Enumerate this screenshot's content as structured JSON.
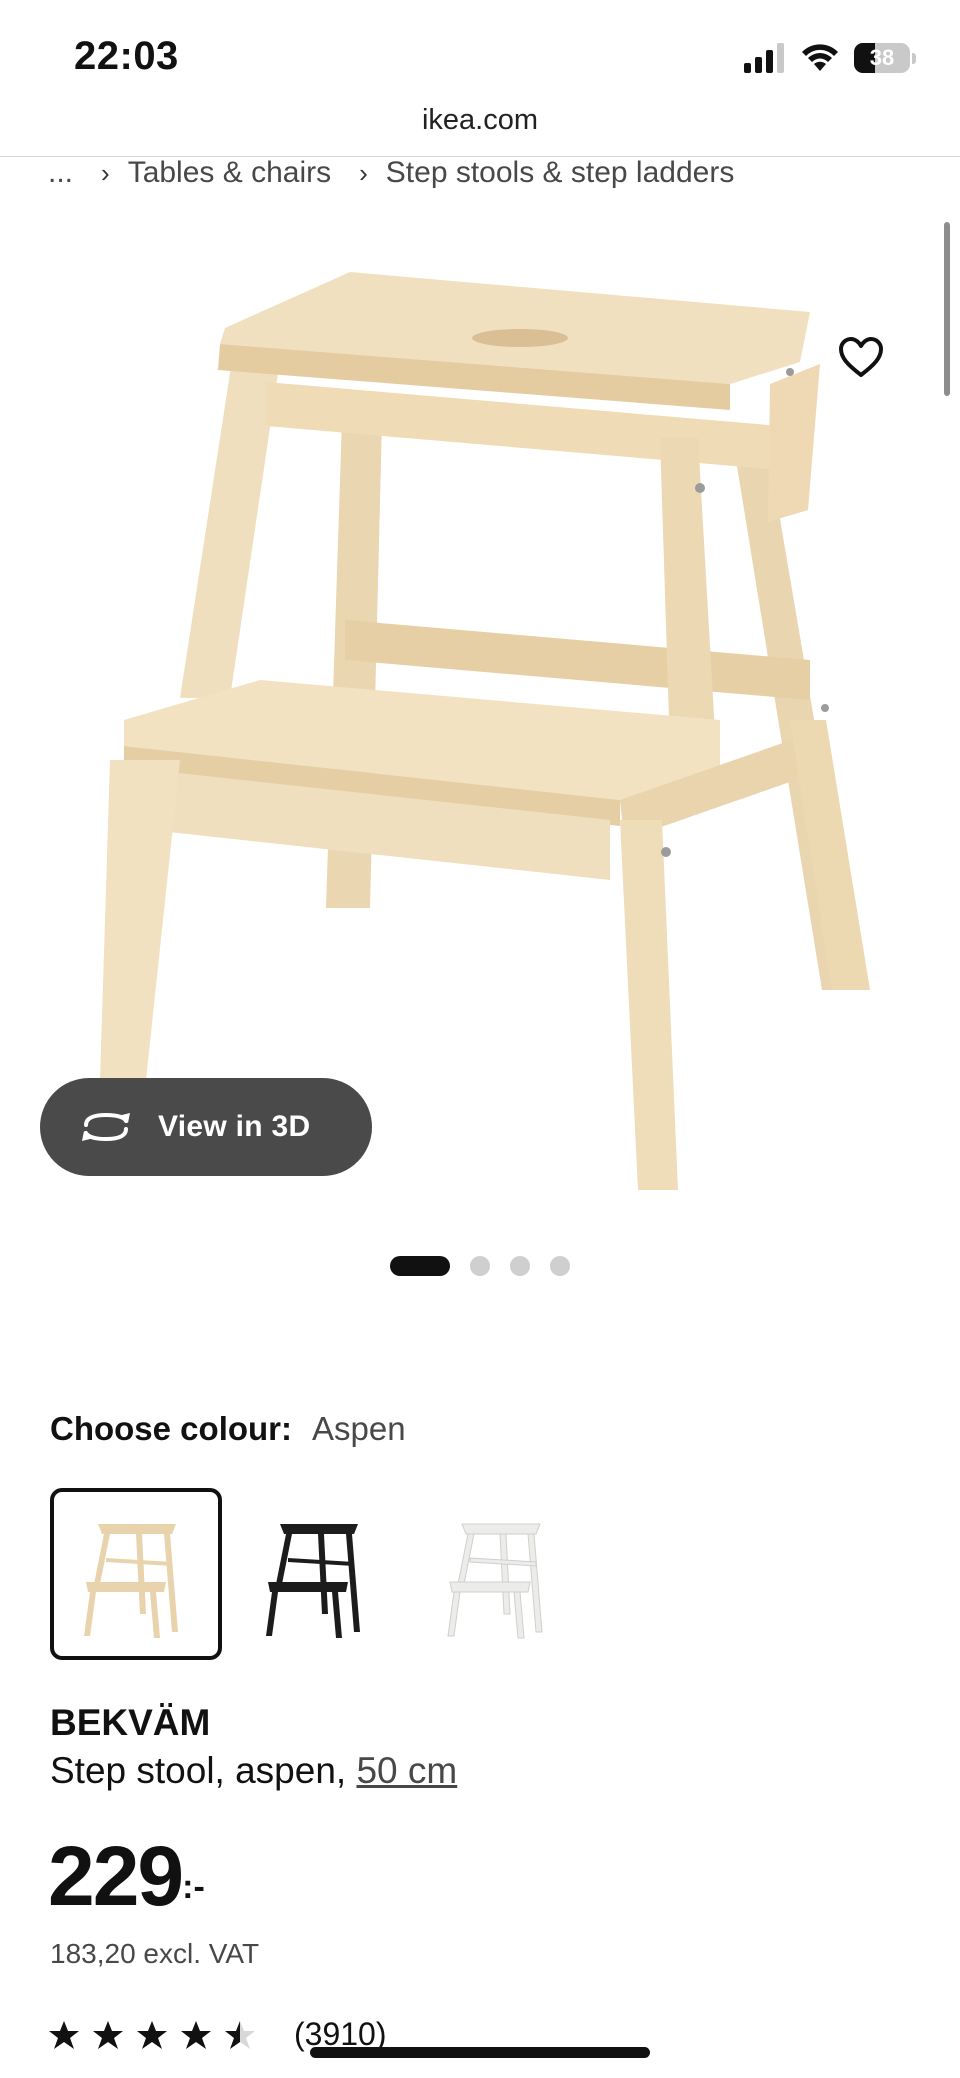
{
  "status_bar": {
    "time": "22:03",
    "battery": "38",
    "battery_level": 38
  },
  "browser": {
    "url": "ikea.com"
  },
  "breadcrumb": {
    "ellipsis": "...",
    "items": [
      "Tables & chairs",
      "Step stools & step ladders"
    ]
  },
  "gallery": {
    "view_3d_label": "View in 3D",
    "dot_count": 4,
    "active_dot": 0
  },
  "colour": {
    "label": "Choose colour:",
    "selected": "Aspen",
    "swatch_colors": [
      "#e8d3ad",
      "#1c1c1c",
      "#ececea"
    ]
  },
  "product": {
    "name": "BEKVÄM",
    "desc_prefix": "Step stool, aspen, ",
    "desc_measure": "50 cm",
    "price_int": "229",
    "price_suffix": ":-",
    "price_excl_vat": "183,20 excl. VAT",
    "rating_stars": 4.5,
    "rating_count": "(3910)"
  },
  "colors": {
    "wood": "#eedcb8",
    "wood_dark": "#dcc397",
    "pill_bg": "#4a4a4a"
  }
}
